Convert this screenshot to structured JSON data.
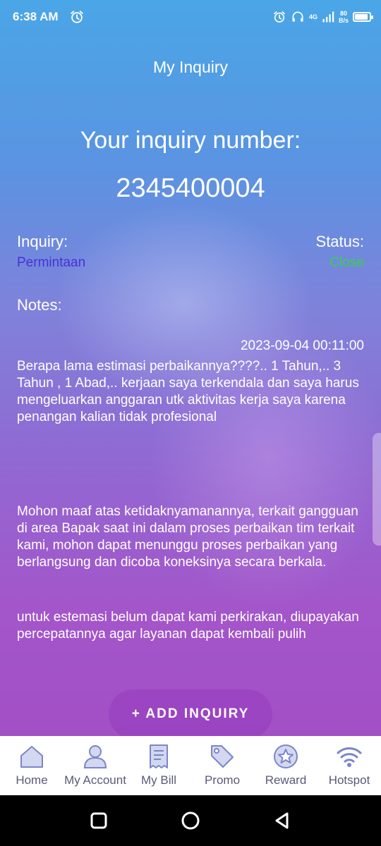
{
  "status_bar": {
    "time": "6:38 AM",
    "network_gen": "4G",
    "speed_value": "80",
    "speed_unit": "B/s",
    "battery_level": 0.9
  },
  "header": {
    "title": "My Inquiry"
  },
  "inquiry": {
    "heading": "Your inquiry number:",
    "number": "2345400004",
    "inquiry_label": "Inquiry:",
    "inquiry_value": "Permintaan",
    "status_label": "Status:",
    "status_value": "Close",
    "notes_label": "Notes:"
  },
  "note": {
    "date": "2023-09-04 00:11:00",
    "message": "Berapa lama estimasi perbaikannya????.. 1 Tahun,.. 3 Tahun , 1 Abad,.. kerjaan saya terkendala dan saya harus mengeluarkan anggaran utk aktivitas kerja saya karena penangan kalian tidak profesional",
    "reply": "Mohon maaf atas ketidaknyamanannya, terkait gangguan di area Bapak saat ini dalam proses perbaikan tim terkait kami, mohon dapat menunggu proses perbaikan yang berlangsung dan dicoba koneksinya secara berkala.",
    "reply_followup": "untuk estemasi belum dapat kami perkirakan, diupayakan percepatannya agar layanan dapat kembali pulih"
  },
  "actions": {
    "add_inquiry": "+ ADD INQUIRY"
  },
  "bottom_nav": [
    {
      "label": "Home",
      "icon": "home-icon"
    },
    {
      "label": "My Account",
      "icon": "user-icon"
    },
    {
      "label": "My Bill",
      "icon": "receipt-icon"
    },
    {
      "label": "Promo",
      "icon": "tag-icon"
    },
    {
      "label": "Reward",
      "icon": "star-badge-icon"
    },
    {
      "label": "Hotspot",
      "icon": "wifi-icon"
    }
  ],
  "colors": {
    "inquiry_value": "#4a2fd8",
    "status_close": "#39d04a",
    "nav_icon": "#7a86c8",
    "nav_label": "#5a5a7a"
  }
}
